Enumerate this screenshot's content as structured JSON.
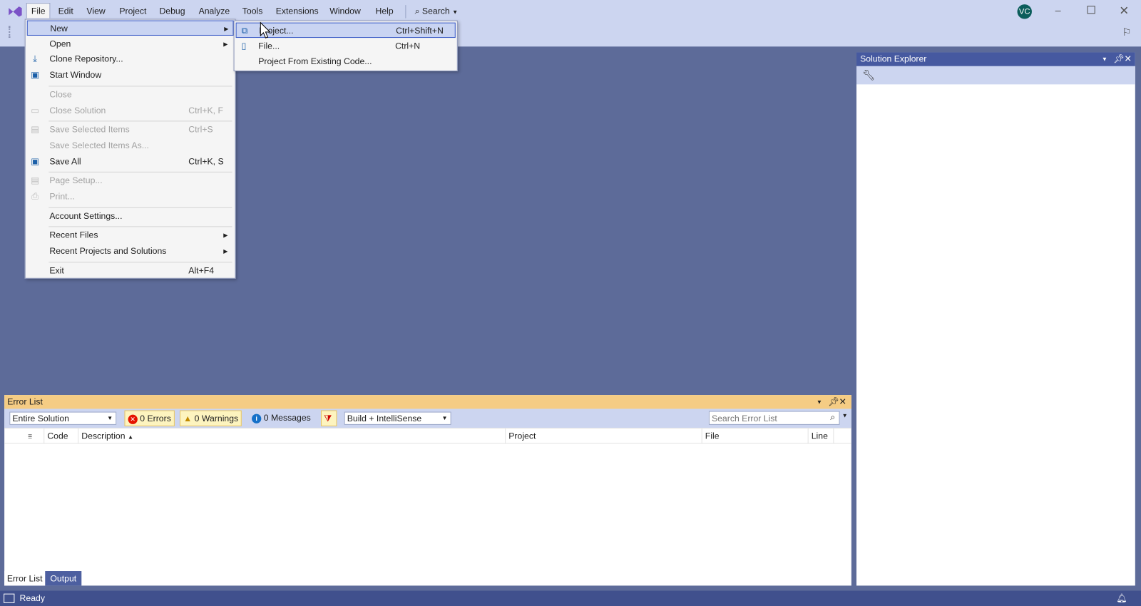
{
  "menubar": {
    "items": [
      "File",
      "Edit",
      "View",
      "Project",
      "Debug",
      "Analyze",
      "Tools",
      "Extensions",
      "Window",
      "Help"
    ],
    "search": "Search",
    "avatar": "VC"
  },
  "file_menu": [
    {
      "label": "New",
      "arrow": true,
      "highlight": true
    },
    {
      "label": "Open",
      "arrow": true
    },
    {
      "label": "Clone Repository...",
      "icon": "clone-repository-icon"
    },
    {
      "label": "Start Window",
      "icon": "start-window-icon"
    },
    {
      "sep": true
    },
    {
      "label": "Close",
      "disabled": true
    },
    {
      "label": "Close Solution",
      "shortcut": "Ctrl+K, F",
      "disabled": true,
      "icon": "close-solution-icon"
    },
    {
      "sep": true
    },
    {
      "label": "Save Selected Items",
      "shortcut": "Ctrl+S",
      "disabled": true,
      "icon": "save-icon"
    },
    {
      "label": "Save Selected Items As...",
      "disabled": true
    },
    {
      "label": "Save All",
      "shortcut": "Ctrl+K, S",
      "icon": "save-all-icon"
    },
    {
      "sep": true
    },
    {
      "label": "Page Setup...",
      "disabled": true,
      "icon": "page-setup-icon"
    },
    {
      "label": "Print...",
      "disabled": true,
      "icon": "print-icon"
    },
    {
      "sep": true
    },
    {
      "label": "Account Settings..."
    },
    {
      "sep": true
    },
    {
      "label": "Recent Files",
      "arrow": true
    },
    {
      "label": "Recent Projects and Solutions",
      "arrow": true
    },
    {
      "sep": true
    },
    {
      "label": "Exit",
      "shortcut": "Alt+F4"
    }
  ],
  "new_submenu": [
    {
      "label": "Project...",
      "shortcut": "Ctrl+Shift+N",
      "highlight": true,
      "icon": "new-project-icon"
    },
    {
      "label": "File...",
      "shortcut": "Ctrl+N",
      "icon": "new-file-icon"
    },
    {
      "label": "Project From Existing Code..."
    }
  ],
  "solution_explorer": {
    "title": "Solution Explorer"
  },
  "error_list": {
    "title": "Error List",
    "scope": "Entire Solution",
    "errors": "0 Errors",
    "warnings": "0 Warnings",
    "messages": "0 Messages",
    "source": "Build + IntelliSense",
    "search_placeholder": "Search Error List",
    "columns": [
      "Code",
      "Description",
      "Project",
      "File",
      "Line"
    ]
  },
  "bottom_tabs": [
    "Error List",
    "Output"
  ],
  "status": {
    "text": "Ready"
  }
}
